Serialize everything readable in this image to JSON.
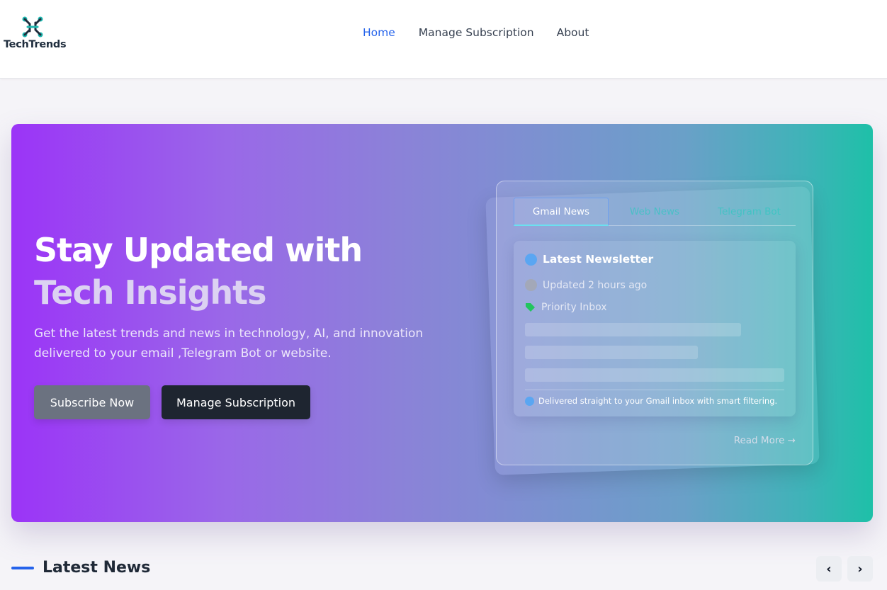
{
  "brand": {
    "name": "TechTrends"
  },
  "nav": {
    "items": [
      "Home",
      "Manage Subscription",
      "About"
    ],
    "active": "Home"
  },
  "hero": {
    "title_line1": "Stay Updated with",
    "title_line2": "Tech Insights",
    "description": "Get the latest trends and news in technology, AI, and innovation delivered to your email ,Telegram Bot or website.",
    "primary_button": "Subscribe Now",
    "secondary_button": "Manage Subscription"
  },
  "card": {
    "tabs": [
      "Gmail News",
      "Web News",
      "Telegram Bot"
    ],
    "active_tab": "Gmail News",
    "title": "Latest Newsletter",
    "updated": "Updated 2 hours ago",
    "tag": "Priority Inbox",
    "footnote": "Delivered straight to your Gmail inbox with smart filtering.",
    "read_more": "Read More →"
  },
  "news": {
    "title": "Latest News",
    "prev": "‹",
    "next": "›"
  },
  "colors": {
    "accent": "#2563eb",
    "dark_button": "#1e2530",
    "grey_button": "#6b7280",
    "tag_green": "#22c55e"
  }
}
